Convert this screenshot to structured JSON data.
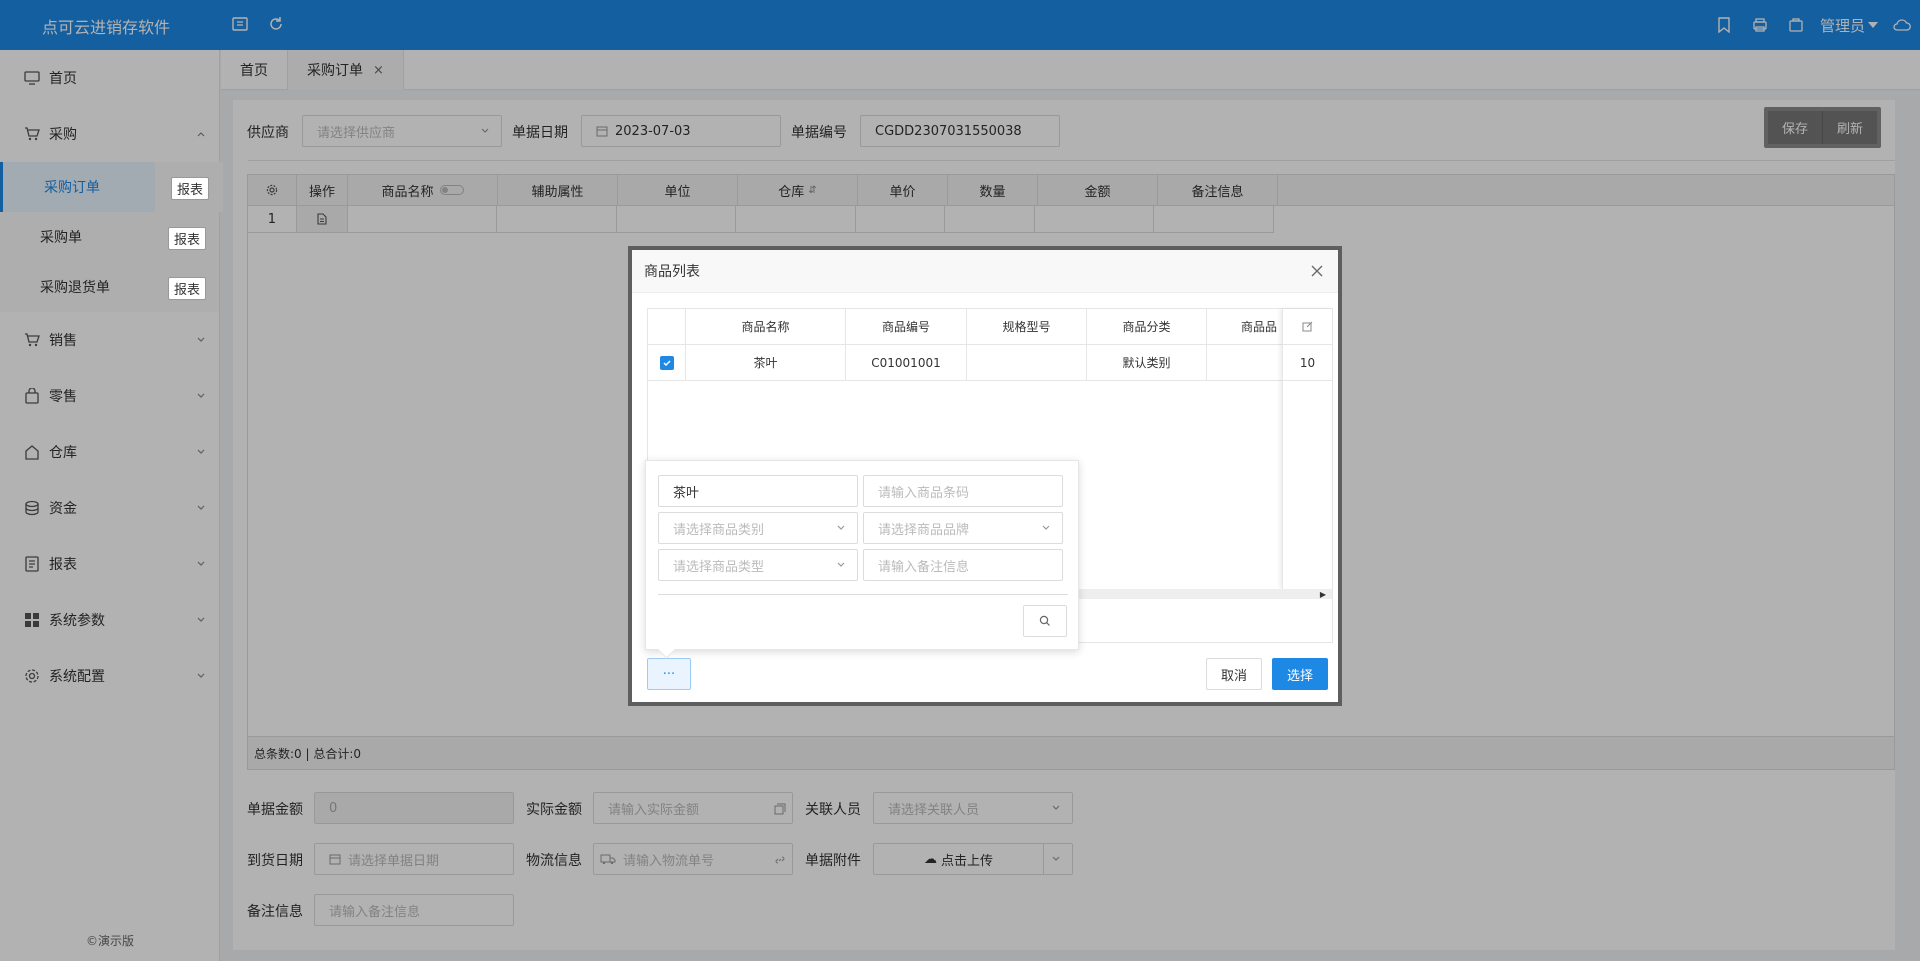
{
  "app": {
    "title": "点可云进销存软件",
    "user": "管理员"
  },
  "sidebar": {
    "items": [
      {
        "label": "首页",
        "icon": "monitor-icon"
      },
      {
        "label": "采购",
        "icon": "cart-icon"
      },
      {
        "label": "销售",
        "icon": "cart-icon"
      },
      {
        "label": "零售",
        "icon": "bag-icon"
      },
      {
        "label": "仓库",
        "icon": "home-icon"
      },
      {
        "label": "资金",
        "icon": "coins-icon"
      },
      {
        "label": "报表",
        "icon": "report-icon"
      },
      {
        "label": "系统参数",
        "icon": "grid-icon"
      },
      {
        "label": "系统配置",
        "icon": "gear-icon"
      }
    ],
    "subitems": [
      {
        "label": "采购订单",
        "report": "报表"
      },
      {
        "label": "采购单",
        "report": "报表"
      },
      {
        "label": "采购退货单",
        "report": "报表"
      }
    ],
    "copyright": "©演示版"
  },
  "tabs": [
    {
      "label": "首页"
    },
    {
      "label": "采购订单",
      "close": "×"
    }
  ],
  "form": {
    "supplier_label": "供应商",
    "supplier_placeholder": "请选择供应商",
    "date_label": "单据日期",
    "date_value": "2023-07-03",
    "number_label": "单据编号",
    "number_value": "CGDD2307031550038",
    "save": "保存",
    "refresh": "刷新"
  },
  "grid": {
    "columns": [
      "",
      "操作",
      "商品名称",
      "辅助属性",
      "单位",
      "仓库",
      "单价",
      "数量",
      "金额",
      "备注信息"
    ],
    "row_index": "1",
    "footer": "总条数:0 | 总合计:0"
  },
  "bottom": {
    "amount_label": "单据金额",
    "amount_value": "0",
    "actual_label": "实际金额",
    "actual_placeholder": "请输入实际金额",
    "related_label": "关联人员",
    "related_placeholder": "请选择关联人员",
    "arrival_label": "到货日期",
    "arrival_placeholder": "请选择单据日期",
    "logistics_label": "物流信息",
    "logistics_placeholder": "请输入物流单号",
    "attachment_label": "单据附件",
    "upload": "点击上传",
    "note_label": "备注信息",
    "note_placeholder": "请输入备注信息"
  },
  "modal": {
    "title": "商品列表",
    "columns": [
      "商品名称",
      "商品编号",
      "规格型号",
      "商品分类",
      "商品品"
    ],
    "rows": [
      {
        "name": "茶叶",
        "code": "C01001001",
        "spec": "",
        "category": "默认类别",
        "brand": "",
        "extra": "10"
      }
    ],
    "cancel": "取消",
    "select": "选择",
    "more": "···"
  },
  "search": {
    "name_value": "茶叶",
    "barcode_placeholder": "请输入商品条码",
    "category_placeholder": "请选择商品类别",
    "brand_placeholder": "请选择商品品牌",
    "type_placeholder": "请选择商品类型",
    "note_placeholder": "请输入备注信息"
  }
}
